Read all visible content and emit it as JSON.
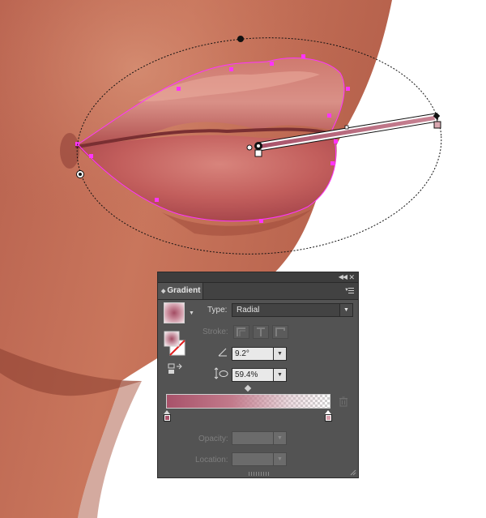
{
  "panel": {
    "tab_label": "Gradient",
    "collapse_icon": "double-chevron-left-icon",
    "close_icon": "close-icon",
    "menu_icon": "panel-menu-icon"
  },
  "type": {
    "label": "Type:",
    "value": "Radial"
  },
  "stroke": {
    "label": "Stroke:"
  },
  "angle": {
    "value": "9.2°"
  },
  "aspect_ratio": {
    "value": "59.4%"
  },
  "opacity": {
    "label": "Opacity:",
    "value": ""
  },
  "location": {
    "label": "Location:",
    "value": ""
  },
  "gradient": {
    "start_color": "#a8526a",
    "end_color": "#ffffff",
    "end_opacity": 0
  },
  "colors": {
    "panel_bg": "#535353",
    "skin": "#c46f58",
    "lip": "#c25f5c",
    "selection": "#ff33ff"
  }
}
